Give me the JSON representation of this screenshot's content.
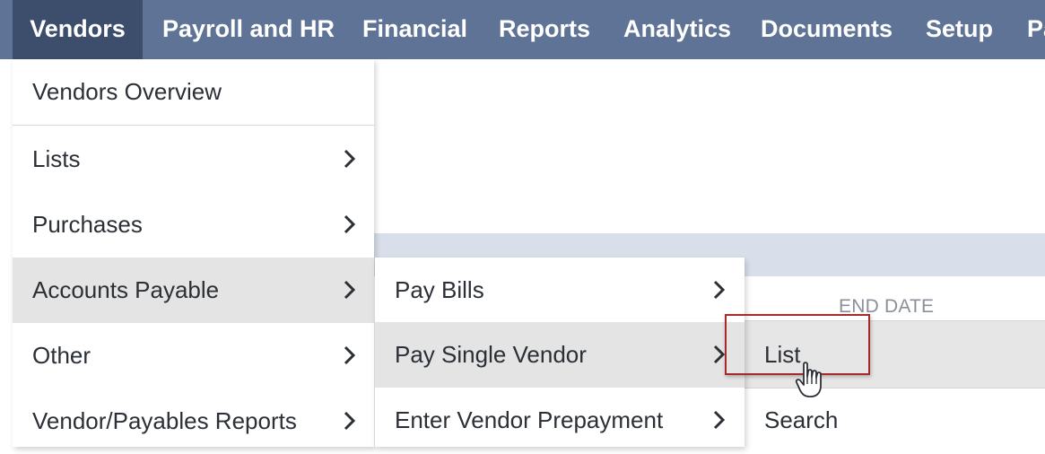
{
  "nav": {
    "items": [
      "Vendors",
      "Payroll and HR",
      "Financial",
      "Reports",
      "Analytics",
      "Documents",
      "Setup",
      "Pa"
    ],
    "active": "Vendors"
  },
  "vendors_menu": {
    "overview": "Vendors Overview",
    "items": [
      "Lists",
      "Purchases",
      "Accounts Payable",
      "Other",
      "Vendor/Payables Reports"
    ],
    "highlighted": "Accounts Payable"
  },
  "accounts_payable_menu": {
    "items": [
      "Pay Bills",
      "Pay Single Vendor",
      "Enter Vendor Prepayment"
    ],
    "highlighted": "Pay Single Vendor"
  },
  "pay_single_vendor_menu": {
    "items": [
      "List",
      "Search"
    ],
    "hovered": "List"
  },
  "background": {
    "end_date_label": "END DATE"
  },
  "icons": {
    "submenu_arrow": "chevron-right-icon",
    "pointer": "hand-cursor-icon"
  },
  "colors": {
    "nav_bg": "#5f7396",
    "nav_active_bg": "#3d4e6c",
    "highlight_bg": "#e4e4e4",
    "annotation_red": "#a52b2b"
  }
}
